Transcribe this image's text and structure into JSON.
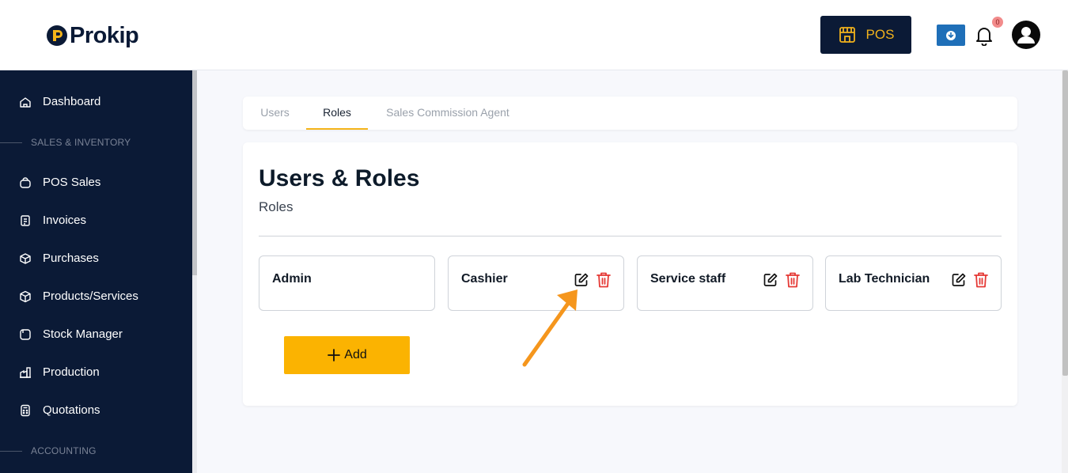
{
  "header": {
    "logo_text": "Prokip",
    "pos_label": "POS",
    "notification_count": "0"
  },
  "sidebar": {
    "items": [
      {
        "label": "Dashboard"
      },
      {
        "label": "POS Sales"
      },
      {
        "label": "Invoices"
      },
      {
        "label": "Purchases"
      },
      {
        "label": "Products/Services"
      },
      {
        "label": "Stock Manager"
      },
      {
        "label": "Production"
      },
      {
        "label": "Quotations"
      }
    ],
    "sections": [
      "SALES & INVENTORY",
      "ACCOUNTING"
    ]
  },
  "tabs": [
    {
      "label": "Users"
    },
    {
      "label": "Roles",
      "active": true
    },
    {
      "label": "Sales Commission Agent"
    }
  ],
  "main": {
    "title": "Users & Roles",
    "subtitle": "Roles",
    "roles": [
      {
        "name": "Admin",
        "editable": false
      },
      {
        "name": "Cashier",
        "editable": true
      },
      {
        "name": "Service staff",
        "editable": true
      },
      {
        "name": "Lab Technician",
        "editable": true
      }
    ],
    "add_label": "Add"
  },
  "colors": {
    "navy": "#0b1a36",
    "accent": "#fbb301",
    "danger": "#e53935",
    "link_blue": "#1f6fb8",
    "annotation_arrow": "#f5961d"
  },
  "icons": [
    "home-icon",
    "bag-icon",
    "receipt-icon",
    "box-icon",
    "cube-icon",
    "stock-icon",
    "factory-icon",
    "calculator-icon",
    "store-icon",
    "download-icon",
    "bell-icon",
    "user-avatar-icon",
    "edit-icon",
    "trash-icon",
    "plus-icon"
  ]
}
